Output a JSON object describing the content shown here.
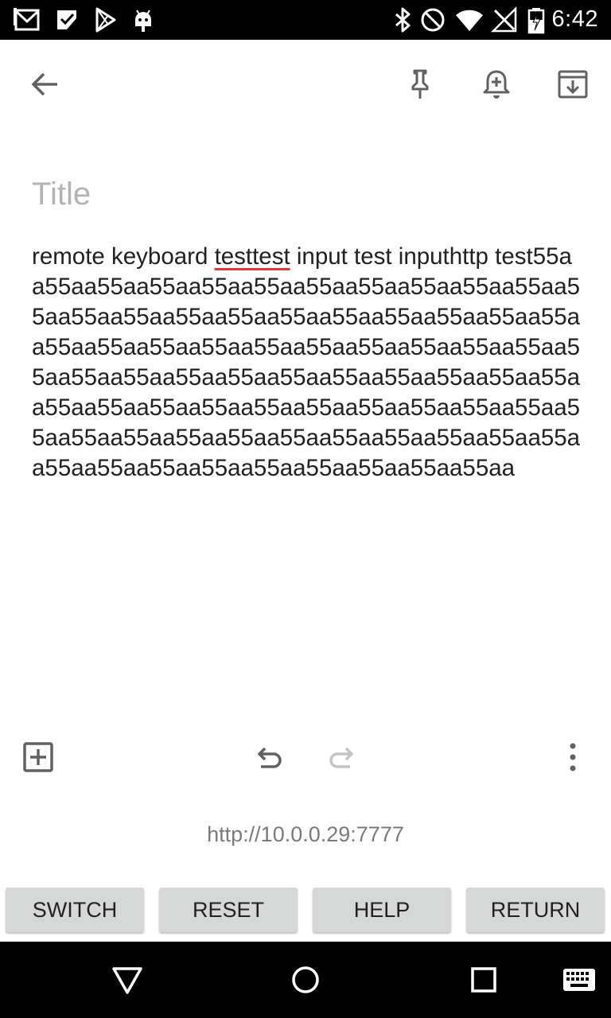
{
  "status_bar": {
    "time": "6:42",
    "left_icons": [
      "gmail-icon",
      "inbox-check-icon",
      "play-store-icon",
      "android-icon"
    ],
    "right_icons": [
      "bluetooth-icon",
      "do-not-disturb-icon",
      "wifi-icon",
      "no-signal-icon",
      "battery-icon"
    ]
  },
  "toolbar": {
    "back_icon": "arrow-back-icon",
    "pin_icon": "pin-icon",
    "reminder_icon": "add-alert-icon",
    "archive_icon": "archive-icon"
  },
  "note": {
    "title_placeholder": "Title",
    "title_value": "",
    "body_prefix": "remote keyboard ",
    "body_misspelled": "testtest",
    "body_suffix": " input test inputhttp test55aa55aa55aa55aa55aa55aa55aa55aa55aa55aa55aa55aa55aa55aa55aa55aa55aa55aa55aa55aa55aa55aa55aa55aa55aa55aa55aa55aa55aa55aa55aa55aa55aa55aa55aa55aa55aa55aa55aa55aa55aa55aa55aa55aa55aa55aa55aa55aa55aa55aa55aa55aa55aa55aa55aa55aa55aa55aa55aa55aa55aa55aa55aa55aa55aa55aa55aa55aa55aa55aa55aa55aa55aa"
  },
  "editor_bar": {
    "add_icon": "add-box-icon",
    "undo_icon": "undo-icon",
    "redo_icon": "redo-icon",
    "more_icon": "more-vert-icon"
  },
  "remote": {
    "url": "http://10.0.0.29:7777",
    "buttons": {
      "switch": "SWITCH",
      "reset": "RESET",
      "help": "HELP",
      "return": "RETURN"
    }
  },
  "nav_bar": {
    "back_icon": "nav-back-icon",
    "home_icon": "nav-home-icon",
    "recents_icon": "nav-recents-icon",
    "keyboard_icon": "keyboard-icon"
  },
  "colors": {
    "status_bar_bg": "#000000",
    "nav_bar_bg": "#000000",
    "button_bg": "#d6d7d7",
    "spellcheck_underline": "#e53935",
    "placeholder": "#b3b3b3",
    "icon_gray": "#616161"
  }
}
